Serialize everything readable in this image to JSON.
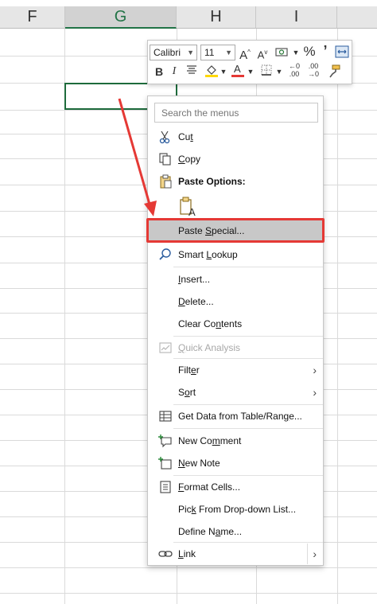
{
  "columns": [
    {
      "name": "F",
      "selected": false
    },
    {
      "name": "G",
      "selected": true
    },
    {
      "name": "H",
      "selected": false
    },
    {
      "name": "I",
      "selected": false
    }
  ],
  "mini_toolbar": {
    "font": "Calibri",
    "size": "11",
    "row1_icons": [
      "increase-font-size-icon",
      "decrease-font-size-icon",
      "accounting-format-icon",
      "percent-style-icon",
      "comma-style-icon",
      "merge-center-icon"
    ],
    "row2_icons": [
      "bold-icon",
      "italic-icon",
      "align-center-icon",
      "fill-color-icon",
      "font-color-icon",
      "borders-icon",
      "increase-decimal-icon",
      "decrease-decimal-icon",
      "format-painter-icon"
    ],
    "fill_color": "#ffd800",
    "font_color": "#e53935"
  },
  "menu": {
    "search_placeholder": "Search the menus",
    "items": {
      "cut": {
        "pre": "Cu",
        "ul": "t",
        "post": ""
      },
      "copy": {
        "pre": "",
        "ul": "C",
        "post": "opy"
      },
      "paste_options": "Paste Options:",
      "paste_special": {
        "pre": "Paste ",
        "ul": "S",
        "post": "pecial..."
      },
      "smart_lookup": {
        "pre": "Smart ",
        "ul": "L",
        "post": "ookup"
      },
      "insert": {
        "pre": "",
        "ul": "I",
        "post": "nsert..."
      },
      "delete": {
        "pre": "",
        "ul": "D",
        "post": "elete..."
      },
      "clear_contents": {
        "pre": "Clear Co",
        "ul": "n",
        "post": "tents"
      },
      "quick_analysis": {
        "pre": "",
        "ul": "Q",
        "post": "uick Analysis"
      },
      "filter": {
        "pre": "Filt",
        "ul": "e",
        "post": "r"
      },
      "sort": {
        "pre": "S",
        "ul": "o",
        "post": "rt"
      },
      "get_data": {
        "pre": "Get Data from Table/Ran",
        "ul": "g",
        "post": "e..."
      },
      "new_comment": {
        "pre": "New Co",
        "ul": "m",
        "post": "ment"
      },
      "new_note": {
        "pre": "",
        "ul": "N",
        "post": "ew Note"
      },
      "format_cells": {
        "pre": "",
        "ul": "F",
        "post": "ormat Cells..."
      },
      "pick_list": {
        "pre": "Pic",
        "ul": "k",
        "post": " From Drop-down List..."
      },
      "define_name": {
        "pre": "Define N",
        "ul": "a",
        "post": "me..."
      },
      "link": {
        "pre": "",
        "ul": "L",
        "post": "ink"
      }
    }
  },
  "annotation": {
    "color": "#e53935"
  }
}
